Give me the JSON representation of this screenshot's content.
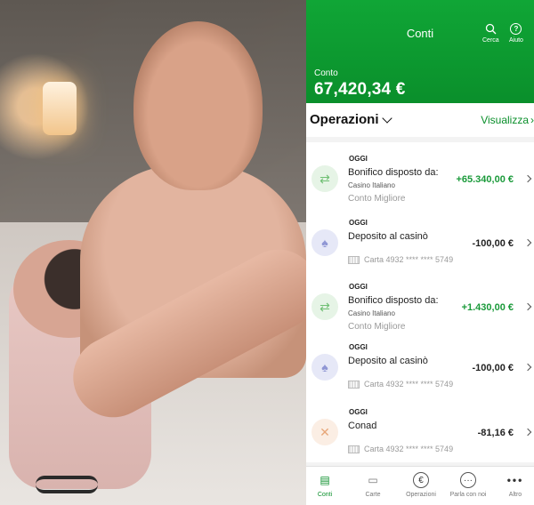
{
  "header": {
    "title": "Conti",
    "search_label": "Cerca",
    "help_label": "Aiuto",
    "account_label": "Conto",
    "account_balance": "67,420,34 €",
    "color": "#0a8f2b"
  },
  "operations": {
    "title": "Operazioni",
    "view_label": "Visualizza"
  },
  "transactions": [
    {
      "day": "OGGI",
      "description": "Bonifico disposto da:",
      "sub": "Casino Italiano",
      "account": "Conto Migliore",
      "amount": "+65.340,00 €",
      "icon": "bonifico-icon"
    },
    {
      "day": "OGGI",
      "description": "Deposito al casinò",
      "card": "Carta 4932 **** **** 5749",
      "amount": "-100,00 €",
      "icon": "casino-icon"
    },
    {
      "day": "OGGI",
      "description": "Bonifico disposto da:",
      "sub": "Casino Italiano",
      "account": "Conto Migliore",
      "amount": "+1.430,00 €",
      "icon": "bonifico-icon"
    },
    {
      "day": "OGGI",
      "description": "Deposito al casinò",
      "card": "Carta 4932 **** **** 5749",
      "amount": "-100,00 €",
      "icon": "casino-icon"
    },
    {
      "day": "OGGI",
      "description": "Conad",
      "card": "Carta 4932 **** **** 5749",
      "amount": "-81,16 €",
      "icon": "food-icon"
    }
  ],
  "tabs": [
    {
      "label": "Conti",
      "icon": "accounts-icon",
      "active": true
    },
    {
      "label": "Carte",
      "icon": "card-icon"
    },
    {
      "label": "Operazioni",
      "icon": "euro-icon"
    },
    {
      "label": "Parla con noi",
      "icon": "chat-icon"
    },
    {
      "label": "Altro",
      "icon": "more-icon"
    }
  ]
}
